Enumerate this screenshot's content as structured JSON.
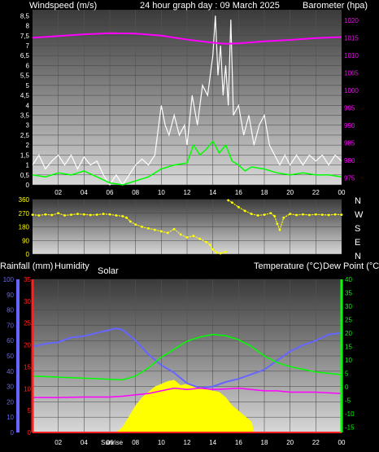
{
  "header": {
    "windspeed_label": "Windspeed (m/s)",
    "title": "24 hour graph day : 09 March 2025",
    "barometer_label": "Barometer (hpa)"
  },
  "middle": {
    "rainfall_label": "Rainfall (mm)",
    "humidity_label": "Humidity",
    "solar_label": "Solar",
    "temperature_label": "Temperature (°C)",
    "dewpoint_label": "Dew Point (°C)",
    "sunrise_label": "Sunrise"
  },
  "compass": [
    "N",
    "W",
    "S",
    "E",
    "N"
  ],
  "x_ticks": [
    "02",
    "04",
    "06",
    "08",
    "10",
    "12",
    "14",
    "16",
    "18",
    "20",
    "22",
    "00"
  ],
  "colors": {
    "wind_gust": "#ffffff",
    "wind_avg": "#00ff00",
    "barometer": "#ff00ff",
    "direction": "#ffff00",
    "humidity": "#6666ff",
    "temperature": "#00ff00",
    "dewpoint": "#ff00ff",
    "solar": "#ffff00",
    "rain": "#ff2020",
    "axis_left_wind": "#ffffff",
    "axis_baro": "#ff00ff",
    "axis_humidity": "#6666ff",
    "axis_rain": "#ff2020",
    "axis_temp": "#00ff00"
  },
  "chart_data": [
    {
      "type": "line",
      "title": "24 hour graph day : 09 March 2025",
      "x_unit": "hour",
      "xlim": [
        0,
        24
      ],
      "ylabel": "Windspeed (m/s)",
      "ylim": [
        0,
        8.8
      ],
      "y_ticks": [
        "0",
        "0,5",
        "1",
        "1,5",
        "2",
        "2,5",
        "3",
        "3,5",
        "4",
        "4,5",
        "5",
        "5,5",
        "6",
        "6,5",
        "7",
        "7,5",
        "8",
        "8,5"
      ],
      "y2label": "Barometer (hpa)",
      "y2lim": [
        973,
        1023
      ],
      "y2_ticks": [
        975,
        980,
        985,
        990,
        995,
        1000,
        1005,
        1010,
        1015,
        1020
      ],
      "series": [
        {
          "name": "Windspeed (m/s)",
          "kind": "gust",
          "axis": "left",
          "x": [
            0,
            0.5,
            1,
            1.5,
            2,
            2.5,
            3,
            3.5,
            4,
            4.5,
            5,
            5.5,
            6,
            6.5,
            7,
            7.5,
            8,
            8.5,
            9,
            9.5,
            10,
            10.3,
            10.6,
            11,
            11.4,
            11.8,
            12,
            12.4,
            12.8,
            13.2,
            13.6,
            14,
            14.2,
            14.4,
            14.6,
            14.8,
            15,
            15.2,
            15.4,
            15.6,
            16,
            16.4,
            16.8,
            17.2,
            17.6,
            18,
            18.4,
            18.8,
            19.2,
            19.6,
            20,
            20.5,
            21,
            21.5,
            22,
            22.5,
            23,
            23.5,
            24
          ],
          "y": [
            1,
            1.5,
            0.8,
            1.2,
            1.5,
            1.0,
            1.5,
            0.8,
            1.4,
            1.0,
            1.2,
            0.5,
            0,
            0.5,
            0,
            0.5,
            1.0,
            1.3,
            1.0,
            1.5,
            4.0,
            3.0,
            2.5,
            3.5,
            2.5,
            3.0,
            2.0,
            4.5,
            3.0,
            5.0,
            4.5,
            6.5,
            8.5,
            5.5,
            7.0,
            4.5,
            6.0,
            4.0,
            8.3,
            3.5,
            4.0,
            2.5,
            3.5,
            2.0,
            3.0,
            3.5,
            2.0,
            1.5,
            1.0,
            1.5,
            1.0,
            1.5,
            1.0,
            1.5,
            1.2,
            1.5,
            1.0,
            1.5,
            1.2
          ]
        },
        {
          "name": "Windspeed (m/s)",
          "kind": "average",
          "axis": "left",
          "x": [
            0,
            1,
            2,
            3,
            4,
            5,
            6,
            7,
            8,
            9,
            10,
            11,
            12,
            12.5,
            13,
            13.5,
            14,
            14.5,
            15,
            15.5,
            16,
            16.5,
            17,
            18,
            19,
            20,
            21,
            22,
            23,
            24
          ],
          "y": [
            0.5,
            0.4,
            0.6,
            0.5,
            0.7,
            0.4,
            0.1,
            0.0,
            0.2,
            0.4,
            0.8,
            1.0,
            1.1,
            2.0,
            1.5,
            1.8,
            2.2,
            1.6,
            2.0,
            1.2,
            1.0,
            0.7,
            0.9,
            0.8,
            0.6,
            0.5,
            0.6,
            0.5,
            0.5,
            0.4
          ]
        },
        {
          "name": "Barometer (hpa)",
          "axis": "right",
          "x": [
            0,
            2,
            4,
            6,
            8,
            10,
            12,
            14,
            15,
            16,
            18,
            20,
            22,
            24
          ],
          "y": [
            1015.0,
            1015.5,
            1016.0,
            1016.3,
            1016.2,
            1015.6,
            1014.5,
            1013.6,
            1013.3,
            1013.4,
            1014.0,
            1014.4,
            1014.9,
            1015.2
          ]
        }
      ]
    },
    {
      "type": "scatter",
      "title": "",
      "ylabel": "",
      "xlim": [
        0,
        24
      ],
      "ylim": [
        0,
        360
      ],
      "y_ticks": [
        0,
        90,
        180,
        270,
        360
      ],
      "series": [
        {
          "name": "",
          "x": [
            0,
            0.5,
            1,
            1.5,
            2,
            2.5,
            3,
            3.5,
            4,
            4.5,
            5,
            5.5,
            6,
            6.5,
            7,
            7.3,
            7.6,
            8,
            8.5,
            9,
            9.5,
            10,
            10.5,
            11,
            11.5,
            12,
            12.5,
            13,
            13.5,
            13.8,
            14,
            14.3,
            14.6,
            15,
            15.2,
            15.5,
            16,
            16.5,
            17,
            17.5,
            18,
            18.5,
            18.8,
            19,
            19.2,
            19.5,
            20,
            20.5,
            21,
            21.5,
            22,
            22.5,
            23,
            23.5,
            24
          ],
          "y": [
            260,
            255,
            262,
            258,
            270,
            255,
            260,
            265,
            262,
            258,
            260,
            265,
            262,
            255,
            250,
            240,
            215,
            195,
            180,
            170,
            160,
            150,
            140,
            165,
            130,
            110,
            120,
            100,
            80,
            60,
            30,
            10,
            5,
            15,
            355,
            340,
            310,
            285,
            265,
            255,
            260,
            270,
            250,
            200,
            160,
            240,
            265,
            258,
            262,
            258,
            262,
            260,
            258,
            262,
            260
          ]
        }
      ]
    },
    {
      "type": "line",
      "title": "",
      "xlim": [
        0,
        24
      ],
      "x_ticks": [
        "02",
        "04",
        "06",
        "08",
        "10",
        "12",
        "14",
        "16",
        "18",
        "20",
        "22",
        "00"
      ],
      "axes": {
        "humidity": {
          "label": "Humidity",
          "ylim": [
            0,
            100
          ],
          "ticks": [
            0,
            10,
            20,
            30,
            40,
            50,
            60,
            70,
            80,
            90,
            100
          ]
        },
        "rainfall": {
          "label": "Rainfall (mm)",
          "ylim": [
            0,
            35
          ],
          "ticks": [
            0,
            5,
            10,
            15,
            20,
            25,
            30,
            35
          ]
        },
        "temperature": {
          "label": "Temperature (°C)",
          "ylim": [
            -17,
            40
          ],
          "ticks": [
            -15,
            -10,
            -5,
            0,
            5,
            10,
            15,
            20,
            25,
            30,
            35,
            40
          ]
        }
      },
      "series": [
        {
          "name": "Humidity",
          "axis": "humidity",
          "x": [
            0,
            1,
            2,
            3,
            4,
            5,
            6,
            6.5,
            7,
            8,
            9,
            10,
            11,
            12,
            13,
            14,
            15,
            16,
            17,
            18,
            19,
            20,
            21,
            22,
            23,
            24
          ],
          "y": [
            56,
            58,
            59,
            62,
            63,
            65,
            67,
            68,
            67,
            60,
            51,
            44,
            39,
            32,
            29,
            30,
            33,
            35,
            38,
            41,
            47,
            53,
            57,
            60,
            64,
            65
          ]
        },
        {
          "name": "Temperature (°C)",
          "axis": "temperature",
          "x": [
            0,
            1,
            2,
            3,
            4,
            5,
            6,
            7,
            8,
            9,
            10,
            11,
            12,
            13,
            14,
            15,
            16,
            17,
            18,
            19,
            20,
            21,
            22,
            23,
            24
          ],
          "y": [
            4,
            3.8,
            3.6,
            3.4,
            3.2,
            3.0,
            2.8,
            2.6,
            4,
            7,
            11,
            14,
            17,
            18.5,
            19.5,
            19,
            17.5,
            15,
            11.5,
            9,
            7.5,
            6.5,
            5.5,
            5,
            4.5
          ]
        },
        {
          "name": "Dew Point (°C)",
          "axis": "temperature",
          "x": [
            0,
            2,
            4,
            6,
            7,
            8,
            9,
            10,
            11,
            12,
            13,
            14,
            15,
            16,
            17,
            18,
            19,
            20,
            22,
            24
          ],
          "y": [
            -4,
            -4,
            -3.8,
            -3.8,
            -3.5,
            -3.0,
            -2.5,
            -1.5,
            -0.5,
            -1,
            -0.5,
            -1,
            -0.8,
            -0.5,
            -1.0,
            -1.5,
            -1.5,
            -2.0,
            -2.0,
            -2.5
          ]
        },
        {
          "name": "Solar",
          "kind": "area",
          "axis": "temperature",
          "x": [
            6.5,
            7,
            7.5,
            8,
            8.5,
            9,
            9.5,
            10,
            10.5,
            11,
            11.5,
            12,
            12.5,
            13,
            13.5,
            14,
            14.5,
            15,
            15.5,
            16,
            16.5,
            17,
            17.2
          ],
          "y": [
            -17,
            -15,
            -11,
            -7,
            -4,
            -2,
            0,
            1,
            2,
            2.5,
            0.5,
            1,
            0,
            -0.5,
            -1,
            -1.5,
            -2,
            -4,
            -7,
            -9,
            -11,
            -13,
            -17
          ]
        },
        {
          "name": "Rainfall (mm)",
          "axis": "rainfall",
          "x": [
            0,
            24
          ],
          "y": [
            0,
            0
          ]
        }
      ]
    }
  ]
}
